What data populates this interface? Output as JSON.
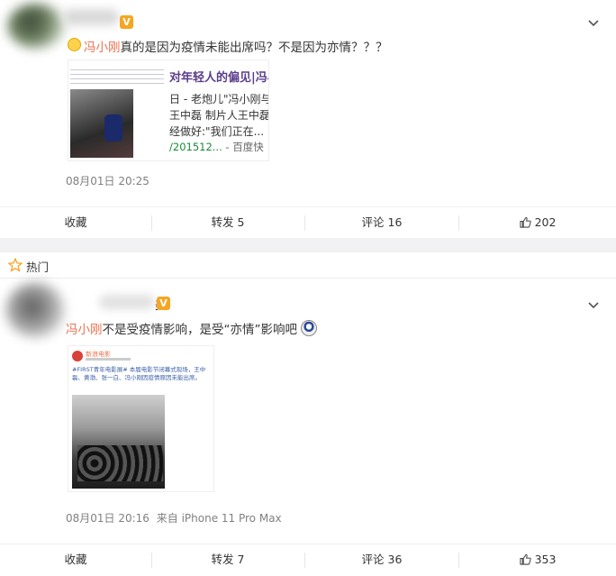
{
  "posts": [
    {
      "vip_badge": "V",
      "mention": "冯小刚",
      "text": "真的是因为疫情未能出席吗？不是因为亦情？？？",
      "image": {
        "headline": "对年轻人的偏见|冯小",
        "line1": "日 - 老炮儿\"冯小刚与\"小",
        "line2": "王中磊 制片人王中磊当",
        "line3": "经做好:\"我们正在...",
        "source_date": "/201512...",
        "source_name": "百度快"
      },
      "time": "08月01日 20:25",
      "actions": {
        "favorite": "收藏",
        "repost": "转发 5",
        "comment": "评论 16",
        "like": "202"
      }
    },
    {
      "vip_badge": "V",
      "name_tail": "美",
      "mention": "冯小刚",
      "text": "不是受疫情影响，是受“亦情”影响吧",
      "image": {
        "account": "新浪电影",
        "snippet": "#FIRST青年电影展# 本届电影节闭幕式现场，王中磊、黄渤、张一白、冯小刚因疫情原因未能出席。"
      },
      "time": "08月01日 20:16",
      "source": "来自 iPhone 11 Pro Max",
      "actions": {
        "favorite": "收藏",
        "repost": "转发 7",
        "comment": "评论 36",
        "like": "353"
      }
    }
  ],
  "hot_label": "热门",
  "colors": {
    "mention": "#eb7350",
    "vip": "#f5a623",
    "hot_star": "#f5a623",
    "time": "#808080"
  }
}
